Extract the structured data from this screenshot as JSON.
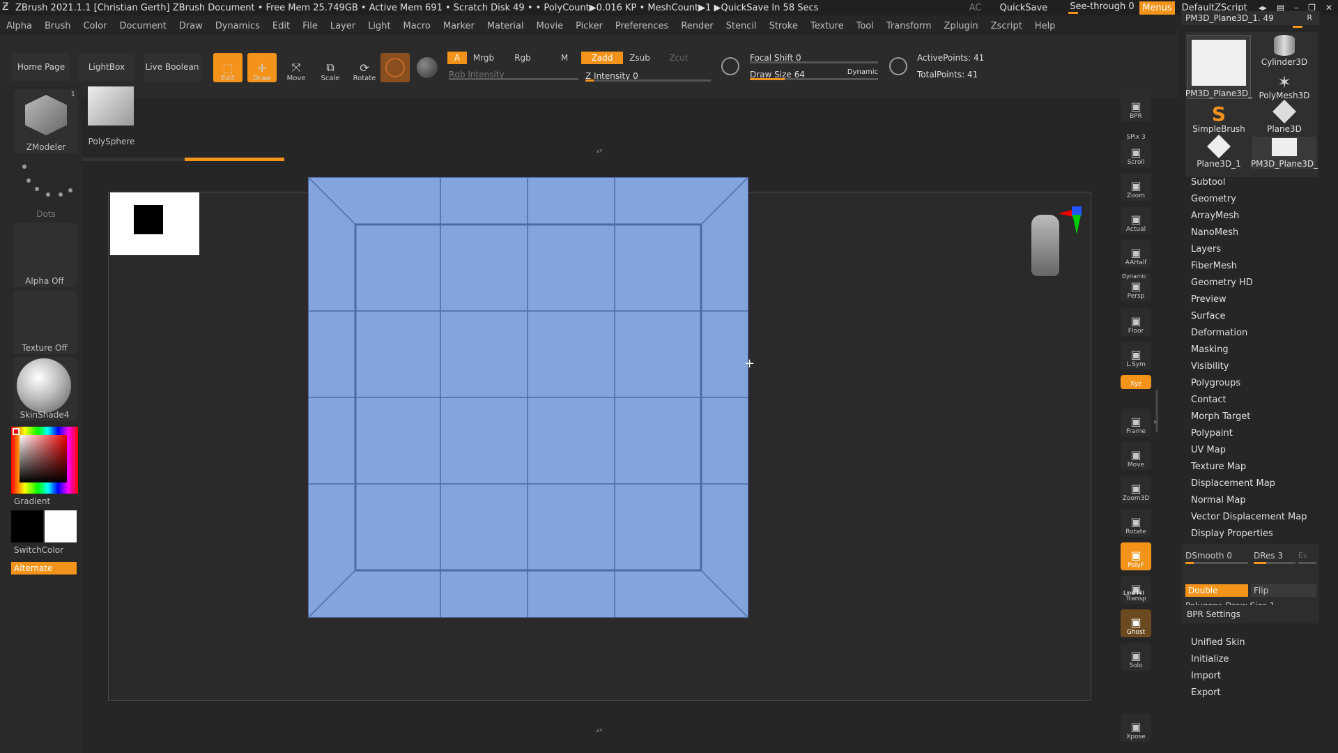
{
  "titlebar": {
    "text": "ZBrush 2021.1.1 [Christian Gerth]   ZBrush Document      • Free Mem 25.749GB • Active Mem 691 • Scratch Disk 49 • • PolyCount▶0.016 KP • MeshCount▶1  ▶QuickSave In 58 Secs",
    "ac": "AC",
    "quicksave": "QuickSave",
    "seethrough": "See-through  0",
    "menus": "Menus",
    "script": "DefaultZScript"
  },
  "menubar": [
    "Alpha",
    "Brush",
    "Color",
    "Document",
    "Draw",
    "Dynamics",
    "Edit",
    "File",
    "Layer",
    "Light",
    "Macro",
    "Marker",
    "Material",
    "Movie",
    "Picker",
    "Preferences",
    "Render",
    "Stencil",
    "Stroke",
    "Texture",
    "Tool",
    "Transform",
    "Zplugin",
    "Zscript",
    "Help"
  ],
  "toolbar": {
    "home": "Home Page",
    "lightbox": "LightBox",
    "liveboolean": "Live Boolean",
    "edit": "Edit",
    "draw": "Draw",
    "move": "Move",
    "scale": "Scale",
    "rotate": "Rotate",
    "a": "A",
    "mrgb": "Mrgb",
    "rgb": "Rgb",
    "m": "M",
    "zadd": "Zadd",
    "zsub": "Zsub",
    "zcut": "Zcut",
    "rgb_intensity": "Rgb Intensity",
    "z_intensity": "Z Intensity 0",
    "focal_shift": "Focal Shift 0",
    "draw_size": "Draw Size 64",
    "dynamic": "Dynamic",
    "active_points": "ActivePoints: 41",
    "total_points": "TotalPoints: 41"
  },
  "left": {
    "zmodeler": "ZModeler",
    "zmodeler_badge": "1",
    "polysphere": "PolySphere",
    "dots": "Dots",
    "alpha": "Alpha Off",
    "texture": "Texture Off",
    "material": "SkinShade4",
    "gradient": "Gradient",
    "switchcolor": "SwitchColor",
    "alternate": "Alternate"
  },
  "rightbar": [
    {
      "name": "bpr",
      "label": "BPR"
    },
    {
      "name": "spix",
      "label": "SPix 3"
    },
    {
      "name": "scroll",
      "label": "Scroll"
    },
    {
      "name": "zoom",
      "label": "Zoom"
    },
    {
      "name": "actual",
      "label": "Actual"
    },
    {
      "name": "aahalf",
      "label": "AAHalf"
    },
    {
      "name": "persp",
      "label": "Persp"
    },
    {
      "name": "floor",
      "label": "Floor"
    },
    {
      "name": "lsym",
      "label": "L.Sym"
    },
    {
      "name": "xyz",
      "label": "Xyz"
    },
    {
      "name": "frame",
      "label": "Frame"
    },
    {
      "name": "move",
      "label": "Move"
    },
    {
      "name": "zoom3d",
      "label": "Zoom3D"
    },
    {
      "name": "rotate",
      "label": "Rotate"
    },
    {
      "name": "polyf",
      "label": "PolyF"
    },
    {
      "name": "transp",
      "label": "Transp"
    },
    {
      "name": "ghost",
      "label": "Ghost"
    },
    {
      "name": "solo",
      "label": "Solo"
    },
    {
      "name": "xpose",
      "label": "Xpose"
    }
  ],
  "rightbar_extra": {
    "dynamic": "Dynamic",
    "linefill": "Line Fill"
  },
  "tools": {
    "header": "PM3D_Plane3D_1. 49",
    "r": "R",
    "items": [
      "PM3D_Plane3D_",
      "Cylinder3D",
      "PolyMesh3D",
      "SimpleBrush",
      "Plane3D",
      "Plane3D_1",
      "PM3D_Plane3D_"
    ]
  },
  "palette": {
    "items": [
      "Subtool",
      "Geometry",
      "ArrayMesh",
      "NanoMesh",
      "Layers",
      "FiberMesh",
      "Geometry HD",
      "Preview",
      "Surface",
      "Deformation",
      "Masking",
      "Visibility",
      "Polygroups",
      "Contact",
      "Morph Target",
      "Polypaint",
      "UV Map",
      "Texture Map",
      "Displacement Map",
      "Normal Map",
      "Vector Displacement Map",
      "Display Properties"
    ],
    "dsmooth": "DSmooth 0",
    "dres": "DRes 3",
    "es": "Es",
    "double": "Double",
    "flip": "Flip",
    "polygons_draw_size": "Polygons Draw Size 1",
    "bpr_settings": "BPR Settings",
    "bottom": [
      "Unified Skin",
      "Initialize",
      "Import",
      "Export"
    ]
  },
  "colors": {
    "accent": "#f39319",
    "mesh": "#84a4de",
    "edge": "#4f6aa0"
  }
}
